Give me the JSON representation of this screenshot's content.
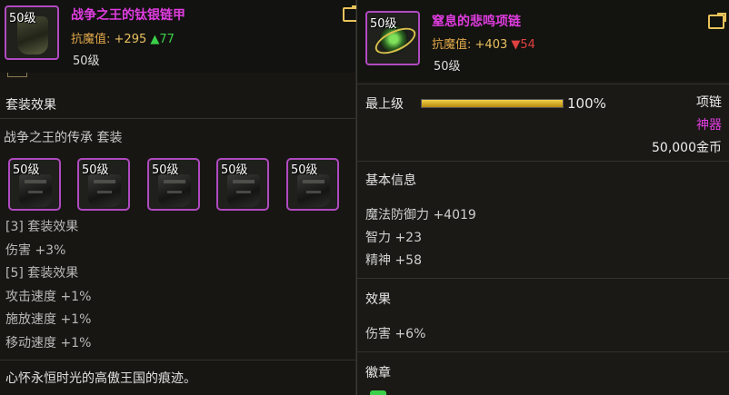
{
  "left_item": {
    "level_badge": "50级",
    "name": "战争之王的钛银链甲",
    "stat_label": "抗魔值:",
    "stat_value": "+295",
    "stat_delta": "▲77",
    "level_text": "50级"
  },
  "left_body": {
    "set_section_title": "套装效果",
    "set_name": "战争之王的传承  套装",
    "set_items": [
      {
        "level": "50级"
      },
      {
        "level": "50级"
      },
      {
        "level": "50级"
      },
      {
        "level": "50级"
      },
      {
        "level": "50级"
      }
    ],
    "set_lines": [
      "[3] 套装效果",
      "伤害 +3%",
      "[5] 套装效果",
      "攻击速度 +1%",
      "施放速度 +1%",
      "移动速度 +1%"
    ],
    "flavor_text": "心怀永恒时光的高傲王国的痕迹。"
  },
  "right_item": {
    "level_badge": "50级",
    "name": "窒息的悲鸣项链",
    "stat_label": "抗魔值:",
    "stat_value": "+403",
    "stat_delta": "▼54",
    "level_text": "50级"
  },
  "right_body": {
    "max_level_label": "最上级",
    "progress_text": "100%",
    "progress_value": 1.0,
    "item_type": "项链",
    "rarity": "神器",
    "price": "50,000金币",
    "basic_info_title": "基本信息",
    "basic_lines": [
      "魔法防御力 +4019",
      "智力 +23",
      "精神 +58"
    ],
    "effect_title": "效果",
    "effect_lines": [
      "伤害 +6%"
    ],
    "emblem_title": "徽章"
  },
  "colors": {
    "rarity_epic": "#e03de0",
    "stat_gold": "#e0a84a",
    "up_green": "#3bd04a",
    "down_red": "#e04040",
    "bar_gold": "#f2d24a"
  },
  "icons": [
    "share-icon",
    "armor-icon",
    "necklace-icon"
  ]
}
